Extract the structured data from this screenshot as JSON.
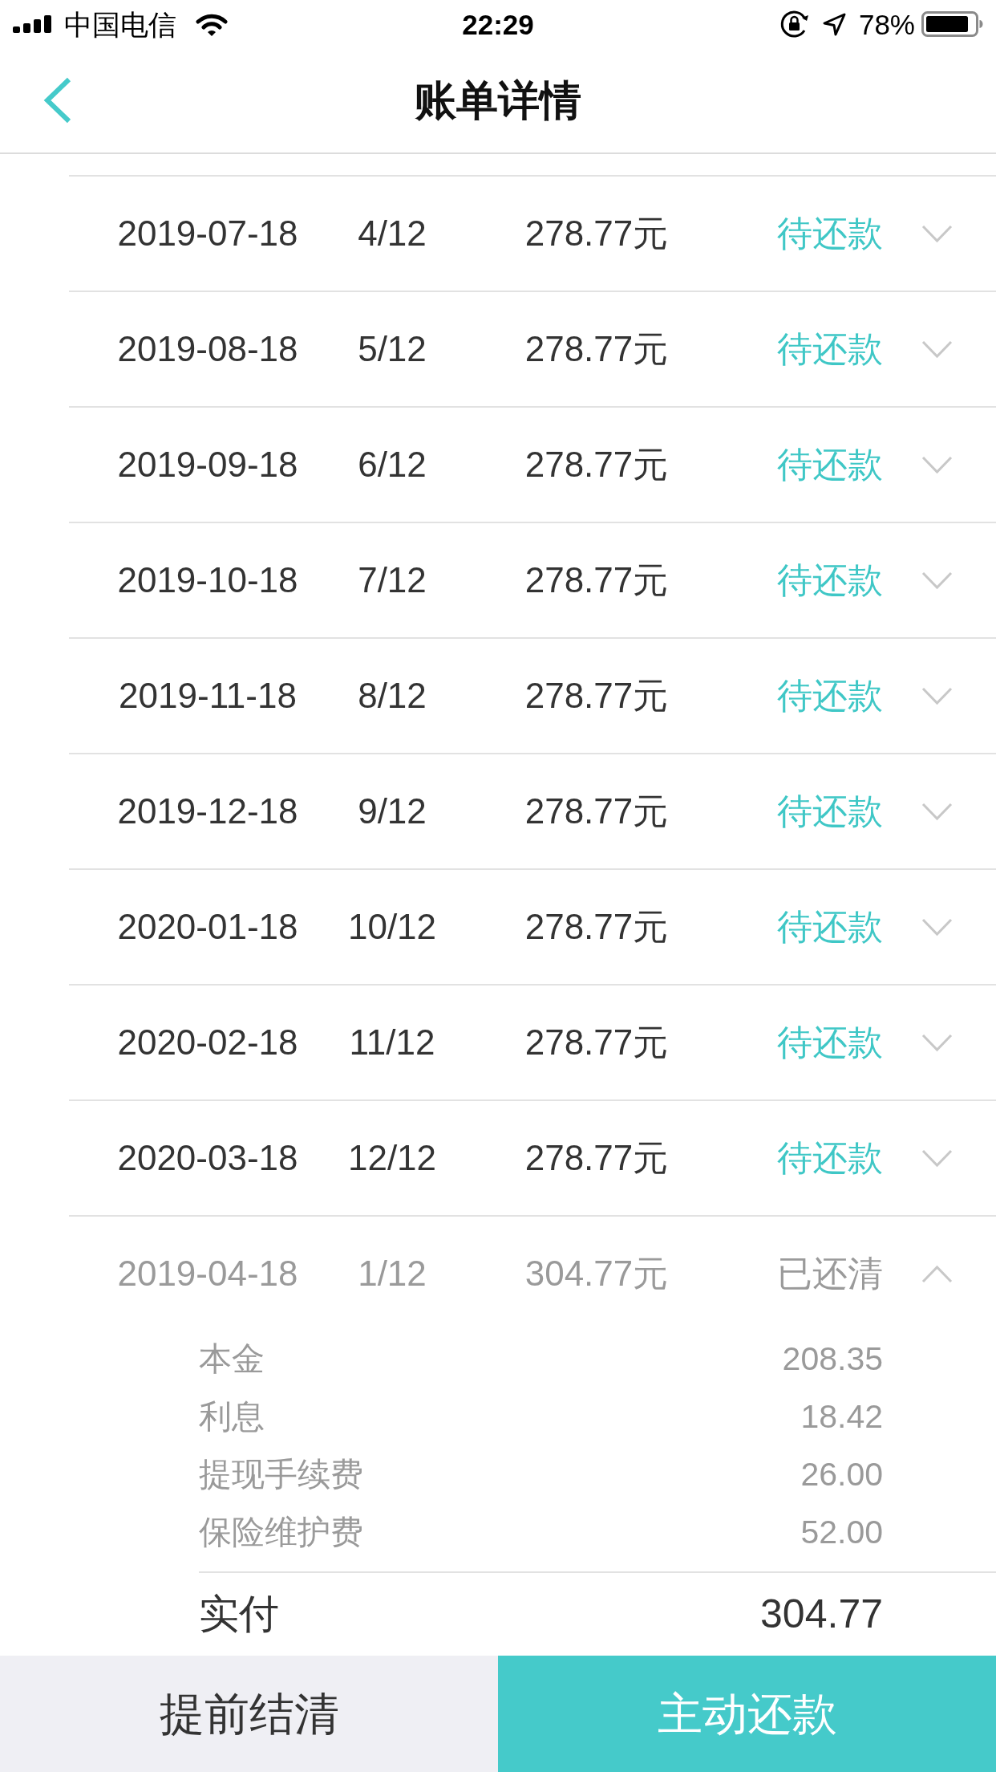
{
  "status_bar": {
    "carrier": "中国电信",
    "time": "22:29",
    "battery": "78%"
  },
  "nav_bar": {
    "title": "账单详情"
  },
  "installments": [
    {
      "date": "2019-07-18",
      "period": "4/12",
      "amount": "278.77元",
      "status": "待还款",
      "kind": "pending",
      "expanded": false
    },
    {
      "date": "2019-08-18",
      "period": "5/12",
      "amount": "278.77元",
      "status": "待还款",
      "kind": "pending",
      "expanded": false
    },
    {
      "date": "2019-09-18",
      "period": "6/12",
      "amount": "278.77元",
      "status": "待还款",
      "kind": "pending",
      "expanded": false
    },
    {
      "date": "2019-10-18",
      "period": "7/12",
      "amount": "278.77元",
      "status": "待还款",
      "kind": "pending",
      "expanded": false
    },
    {
      "date": "2019-11-18",
      "period": "8/12",
      "amount": "278.77元",
      "status": "待还款",
      "kind": "pending",
      "expanded": false
    },
    {
      "date": "2019-12-18",
      "period": "9/12",
      "amount": "278.77元",
      "status": "待还款",
      "kind": "pending",
      "expanded": false
    },
    {
      "date": "2020-01-18",
      "period": "10/12",
      "amount": "278.77元",
      "status": "待还款",
      "kind": "pending",
      "expanded": false
    },
    {
      "date": "2020-02-18",
      "period": "11/12",
      "amount": "278.77元",
      "status": "待还款",
      "kind": "pending",
      "expanded": false
    },
    {
      "date": "2020-03-18",
      "period": "12/12",
      "amount": "278.77元",
      "status": "待还款",
      "kind": "pending",
      "expanded": false
    },
    {
      "date": "2019-04-18",
      "period": "1/12",
      "amount": "304.77元",
      "status": "已还清",
      "kind": "paid",
      "expanded": true,
      "breakdown": [
        {
          "label": "本金",
          "value": "208.35"
        },
        {
          "label": "利息",
          "value": "18.42"
        },
        {
          "label": "提现手续费",
          "value": "26.00"
        },
        {
          "label": "保险维护费",
          "value": "52.00"
        }
      ],
      "total": {
        "label": "实付",
        "value": "304.77"
      }
    }
  ],
  "actions": [
    {
      "label": "提前结清",
      "kind": "secondary"
    },
    {
      "label": "主动还款",
      "kind": "primary"
    }
  ]
}
